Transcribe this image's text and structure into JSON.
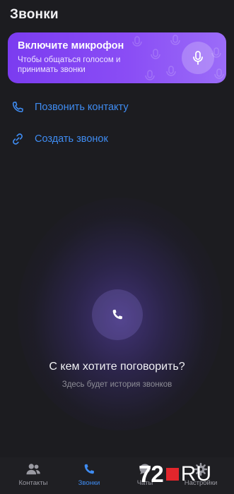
{
  "header": {
    "title": "Звонки"
  },
  "mic_banner": {
    "title": "Включите микрофон",
    "subtitle": "Чтобы общаться голосом и принимать звонки"
  },
  "actions": [
    {
      "label": "Позвонить контакту",
      "icon": "phone-icon"
    },
    {
      "label": "Создать звонок",
      "icon": "link-icon"
    }
  ],
  "empty_state": {
    "title": "С кем хотите поговорить?",
    "subtitle": "Здесь будет история звонков"
  },
  "tabs": [
    {
      "label": "Контакты",
      "icon": "contacts-icon",
      "active": false
    },
    {
      "label": "Звонки",
      "icon": "phone-icon",
      "active": true
    },
    {
      "label": "Чаты",
      "icon": "chat-icon",
      "active": false
    },
    {
      "label": "Настройки",
      "icon": "gear-icon",
      "active": false
    }
  ],
  "watermark": {
    "number": "72",
    "text": "RU"
  },
  "colors": {
    "background": "#1c1c20",
    "accent": "#3f8cf2",
    "banner_start": "#7b3cf0",
    "banner_end": "#9b6cf8",
    "watermark_red": "#e3262c"
  }
}
